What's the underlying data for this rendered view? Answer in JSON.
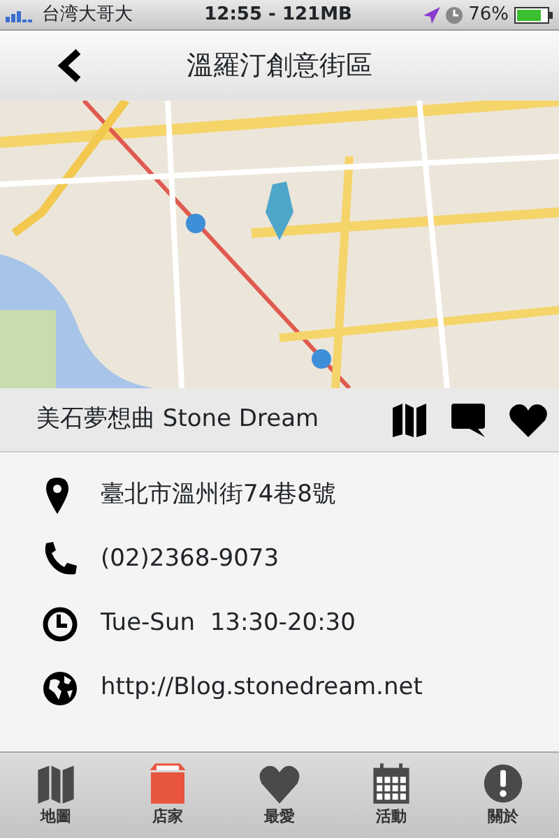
{
  "status_bar": {
    "carrier": "台湾大哥大",
    "time": "12:55 - 121MB",
    "battery": "76%"
  },
  "nav_bar": {
    "title": "溫羅汀創意街區"
  },
  "store": {
    "name": "美石夢想曲 Stone Dream"
  },
  "details": [
    {
      "kind": "address",
      "text": "臺北市溫州街74巷8號"
    },
    {
      "kind": "phone",
      "text": "(02)2368-9073"
    },
    {
      "kind": "hours",
      "text": "Tue-Sun  13:30-20:30"
    },
    {
      "kind": "web",
      "text": "http://Blog.stonedream.net"
    }
  ],
  "tabs": [
    {
      "kind": "map",
      "label": "地圖",
      "selected": false
    },
    {
      "kind": "store",
      "label": "店家",
      "selected": true
    },
    {
      "kind": "favorite",
      "label": "最愛",
      "selected": false
    },
    {
      "kind": "event",
      "label": "活動",
      "selected": false
    },
    {
      "kind": "about",
      "label": "關於",
      "selected": false
    }
  ]
}
